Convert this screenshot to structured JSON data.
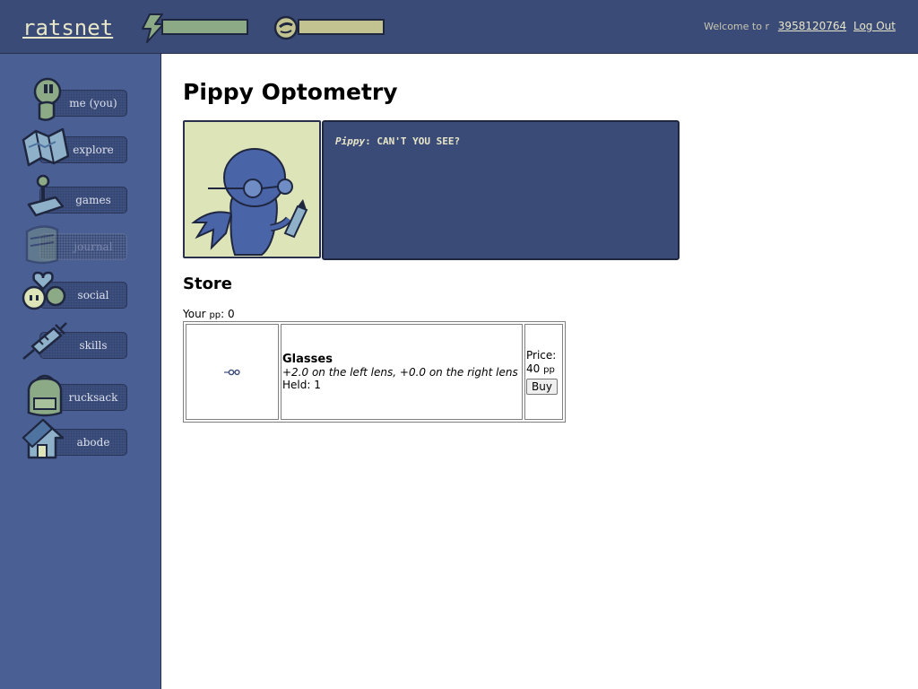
{
  "header": {
    "logo": "ratsnet",
    "energy_bar": {
      "icon": "lightning-icon",
      "level": 1.0,
      "color": "#8daa87"
    },
    "mood_bar": {
      "icon": "smiley-face-icon",
      "level": 1.0,
      "color": "#c2c391"
    },
    "welcome_text": "Welcome to r",
    "user_id": "3958120764",
    "logout_label": "Log Out"
  },
  "sidebar": {
    "items": [
      {
        "label": "me (you)",
        "icon": "person-icon",
        "enabled": true
      },
      {
        "label": "explore",
        "icon": "map-icon",
        "enabled": true
      },
      {
        "label": "games",
        "icon": "joystick-icon",
        "enabled": true
      },
      {
        "label": "journal",
        "icon": "journal-icon",
        "enabled": false
      },
      {
        "label": "social",
        "icon": "heart-icon",
        "enabled": true
      },
      {
        "label": "skills",
        "icon": "syringe-icon",
        "enabled": true
      },
      {
        "label": "rucksack",
        "icon": "backpack-icon",
        "enabled": true
      },
      {
        "label": "abode",
        "icon": "house-icon",
        "enabled": true
      }
    ]
  },
  "main": {
    "title": "Pippy Optometry",
    "portrait": {
      "icon": "pippy-portrait-icon"
    },
    "dialog": {
      "speaker": "Pippy",
      "separator": ": ",
      "text": "CAN'T YOU SEE?"
    },
    "store": {
      "heading": "Store",
      "your_pp_label": "Your",
      "pp_unit": "pp",
      "your_pp_sep": ":",
      "your_pp_value": "0",
      "items": [
        {
          "icon": "glasses-icon",
          "name": "Glasses",
          "effect": "+2.0 on the left lens, +0.0 on the right lens",
          "held_label": "Held: 1",
          "price_label": "Price:",
          "price_value": "40",
          "price_unit": "pp",
          "buy_label": "Buy"
        }
      ]
    }
  },
  "colors": {
    "header_bg": "#3b4b77",
    "sidebar_bg": "#4a5f93",
    "dialog_bg": "#3b4b77",
    "accent_text": "#e8e6c8"
  }
}
